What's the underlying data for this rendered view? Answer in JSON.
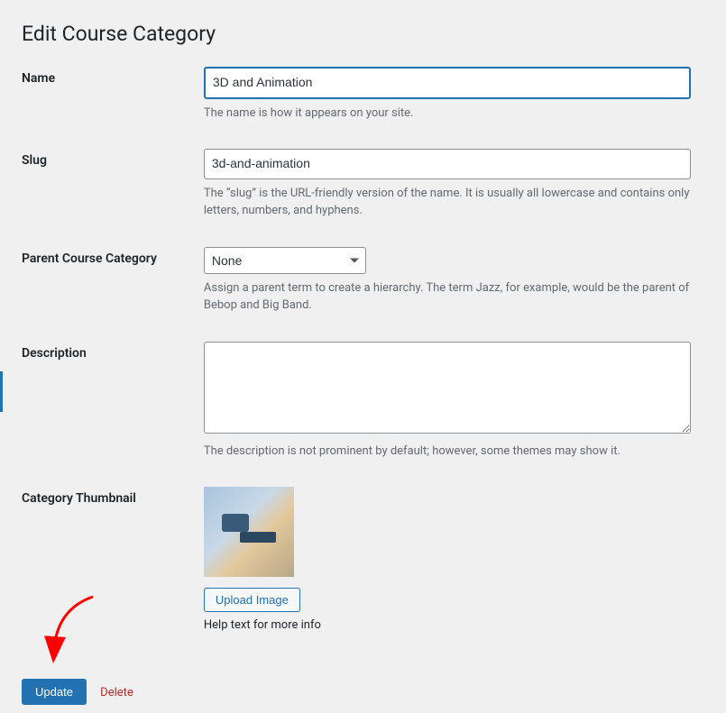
{
  "page_title": "Edit Course Category",
  "fields": {
    "name": {
      "label": "Name",
      "value": "3D and Animation",
      "description": "The name is how it appears on your site."
    },
    "slug": {
      "label": "Slug",
      "value": "3d-and-animation",
      "description": "The “slug” is the URL-friendly version of the name. It is usually all lowercase and contains only letters, numbers, and hyphens."
    },
    "parent": {
      "label": "Parent Course Category",
      "value": "None",
      "description": "Assign a parent term to create a hierarchy. The term Jazz, for example, would be the parent of Bebop and Big Band."
    },
    "description": {
      "label": "Description",
      "value": "",
      "description": "The description is not prominent by default; however, some themes may show it."
    },
    "thumbnail": {
      "label": "Category Thumbnail",
      "upload_label": "Upload Image",
      "help_text": "Help text for more info"
    }
  },
  "actions": {
    "update_label": "Update",
    "delete_label": "Delete"
  }
}
